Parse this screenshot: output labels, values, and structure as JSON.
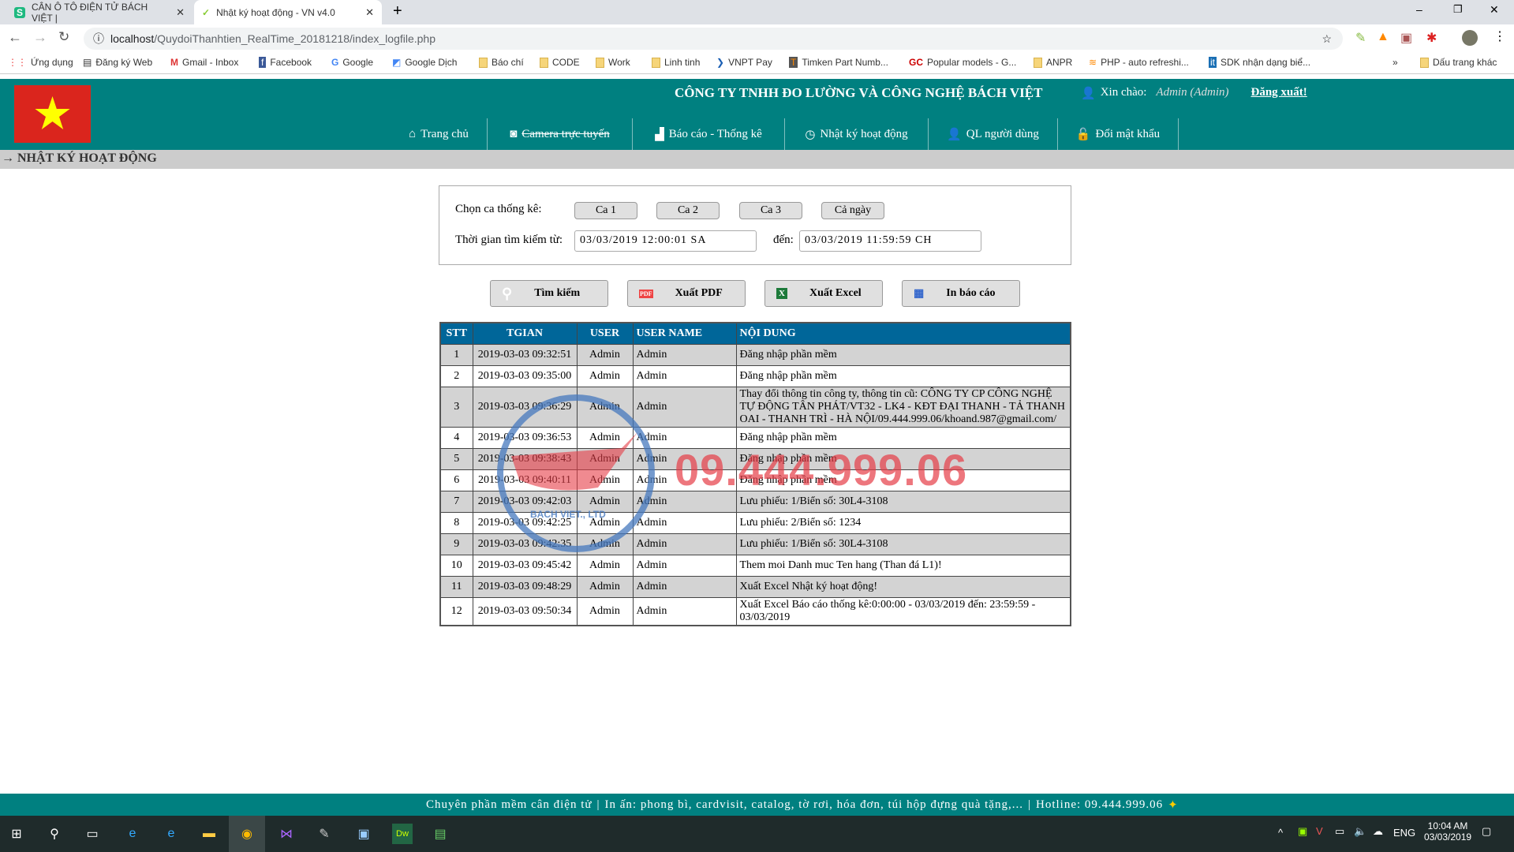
{
  "browser": {
    "tabs": [
      {
        "label": "CÂN Ô TÔ ĐIỆN TỬ BÁCH VIỆT |",
        "active": false
      },
      {
        "label": "Nhật ký hoạt động - VN v4.0",
        "active": true
      }
    ],
    "url_host": "localhost",
    "url_path": "/QuydoiThanhtien_RealTime_20181218/index_logfile.php",
    "bookmarks": [
      "Ứng dụng",
      "Đăng ký Web",
      "Gmail - Inbox",
      "Facebook",
      "Google",
      "Google Dịch",
      "Báo chí",
      "CODE",
      "Work",
      "Linh tinh",
      "VNPT Pay",
      "Timken Part Numb...",
      "Popular models - G...",
      "ANPR",
      "PHP - auto refreshi...",
      "SDK nhận dạng biể..."
    ],
    "other_bookmarks": "Dấu trang khác"
  },
  "header": {
    "company": "CÔNG TY TNHH ĐO LƯỜNG VÀ CÔNG NGHỆ BÁCH VIỆT",
    "greeting": "Xin chào:",
    "user": "Admin (Admin)",
    "logout": "Đăng xuất!"
  },
  "nav": [
    "Trang chủ",
    "Camera trực tuyến",
    "Báo cáo - Thống kê",
    "Nhật ký hoạt động",
    "QL người dùng",
    "Đổi mật khẩu"
  ],
  "breadcrumb": "→ NHẬT KÝ HOẠT ĐỘNG",
  "filter": {
    "shift_label": "Chọn ca thống kê:",
    "shifts": [
      "Ca 1",
      "Ca 2",
      "Ca 3",
      "Cả ngày"
    ],
    "time_label": "Thời gian tìm kiếm từ:",
    "from": "03/03/2019 12:00:01 SA",
    "to_label": "đến:",
    "to": "03/03/2019 11:59:59 CH"
  },
  "actions": [
    "Tìm kiếm",
    "Xuất PDF",
    "Xuất Excel",
    "In báo cáo"
  ],
  "table": {
    "headers": [
      "STT",
      "TGIAN",
      "USER",
      "USER NAME",
      "NỘI DUNG"
    ],
    "rows": [
      [
        "1",
        "2019-03-03 09:32:51",
        "Admin",
        "Admin",
        "Đăng nhập phần mềm"
      ],
      [
        "2",
        "2019-03-03 09:35:00",
        "Admin",
        "Admin",
        "Đăng nhập phần mềm"
      ],
      [
        "3",
        "2019-03-03 09:36:29",
        "Admin",
        "Admin",
        "Thay đổi thông tin công ty, thông tin cũ: CÔNG TY CP CÔNG NGHỆ TỰ ĐỘNG TÂN PHÁT/VT32 - LK4 - KĐT ĐẠI THANH - TẢ THANH OAI - THANH TRÌ - HÀ NỘI/09.444.999.06/khoand.987@gmail.com/"
      ],
      [
        "4",
        "2019-03-03 09:36:53",
        "Admin",
        "Admin",
        "Đăng nhập phần mềm"
      ],
      [
        "5",
        "2019-03-03 09:38:43",
        "Admin",
        "Admin",
        "Đăng nhập phần mềm"
      ],
      [
        "6",
        "2019-03-03 09:40:11",
        "Admin",
        "Admin",
        "Đăng nhập phần mềm"
      ],
      [
        "7",
        "2019-03-03 09:42:03",
        "Admin",
        "Admin",
        "Lưu phiếu: 1/Biển số: 30L4-3108"
      ],
      [
        "8",
        "2019-03-03 09:42:25",
        "Admin",
        "Admin",
        "Lưu phiếu: 2/Biển số: 1234"
      ],
      [
        "9",
        "2019-03-03 09:42:35",
        "Admin",
        "Admin",
        "Lưu phiếu: 1/Biển số: 30L4-3108"
      ],
      [
        "10",
        "2019-03-03 09:45:42",
        "Admin",
        "Admin",
        "Them moi Danh muc Ten hang (Than đá L1)!"
      ],
      [
        "11",
        "2019-03-03 09:48:29",
        "Admin",
        "Admin",
        "Xuất Excel Nhật ký hoạt động!"
      ],
      [
        "12",
        "2019-03-03 09:50:34",
        "Admin",
        "Admin",
        "Xuất Excel Báo cáo thống kê:0:00:00 - 03/03/2019 đến: 23:59:59 - 03/03/2019"
      ]
    ]
  },
  "watermark": {
    "phone": "09.444.999.06",
    "company": "BACH VIET., LTD"
  },
  "footer": {
    "link1": "Chuyên phần mềm cân điện tử",
    "link2": "In ấn: phong bì, cardvisit, catalog, tờ rơi, hóa đơn, túi hộp đựng quà tặng,...",
    "hotline": "Hotline: 09.444.999.06"
  },
  "taskbar": {
    "lang": "ENG",
    "time": "10:04 AM",
    "date": "03/03/2019"
  },
  "colors": {
    "teal": "#008080",
    "table_header": "#006699",
    "flag_red": "#da251d",
    "flag_star": "#ffff00"
  }
}
